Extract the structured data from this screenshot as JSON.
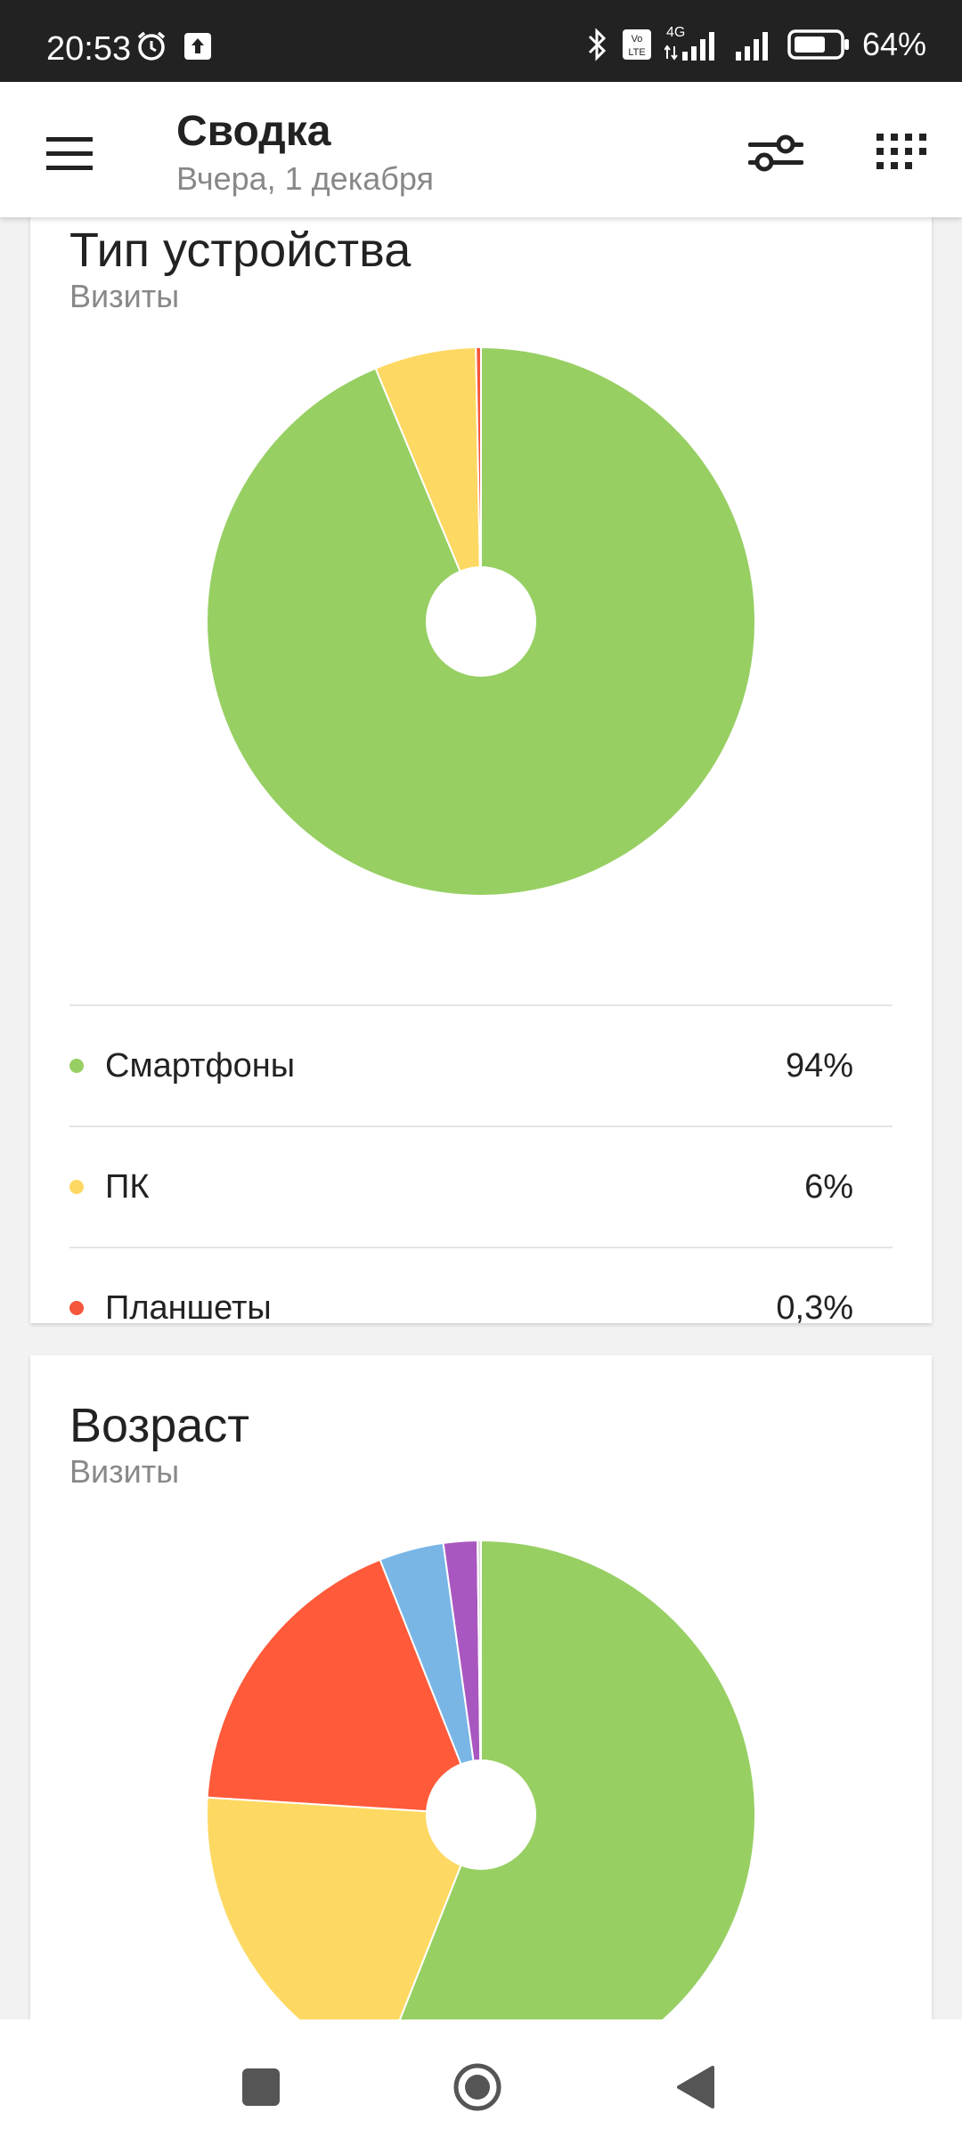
{
  "status_bar": {
    "time": "20:53",
    "battery": "64%",
    "network": "4G",
    "icons": [
      "alarm-icon",
      "upload-icon",
      "bluetooth-icon",
      "volte-icon",
      "signal-icon",
      "signal-icon-2",
      "battery-icon"
    ]
  },
  "app_bar": {
    "title": "Сводка",
    "subtitle": "Вчера, 1 декабря",
    "icons": [
      "menu-icon",
      "filter-icon",
      "apps-grid-icon"
    ]
  },
  "cards": {
    "device": {
      "title": "Тип устройства",
      "subtitle": "Визиты",
      "legend": [
        {
          "label": "Смартфоны",
          "value": "94%",
          "color": "#97cf63"
        },
        {
          "label": "ПК",
          "value": "6%",
          "color": "#fdd963"
        },
        {
          "label": "Планшеты",
          "value": "0,3%",
          "color": "#f5573c"
        }
      ]
    },
    "age": {
      "title": "Возраст",
      "subtitle": "Визиты"
    }
  },
  "chart_data": [
    {
      "type": "pie",
      "title": "Тип устройства",
      "subtitle": "Визиты",
      "categories": [
        "Смартфоны",
        "ПК",
        "Планшеты"
      ],
      "values": [
        94,
        6,
        0.3
      ],
      "colors": [
        "#97cf63",
        "#fdd963",
        "#f5573c"
      ],
      "donut": true
    },
    {
      "type": "pie",
      "title": "Возраст",
      "subtitle": "Визиты",
      "values": [
        56,
        20,
        18,
        3.8,
        2,
        0.2
      ],
      "colors": [
        "#97cf63",
        "#fdd963",
        "#ff5a3a",
        "#79b6e6",
        "#a957c0",
        "#d9d9d9"
      ],
      "donut": true
    }
  ],
  "nav_bar": {
    "icons": [
      "recents-icon",
      "home-icon",
      "back-icon"
    ]
  }
}
